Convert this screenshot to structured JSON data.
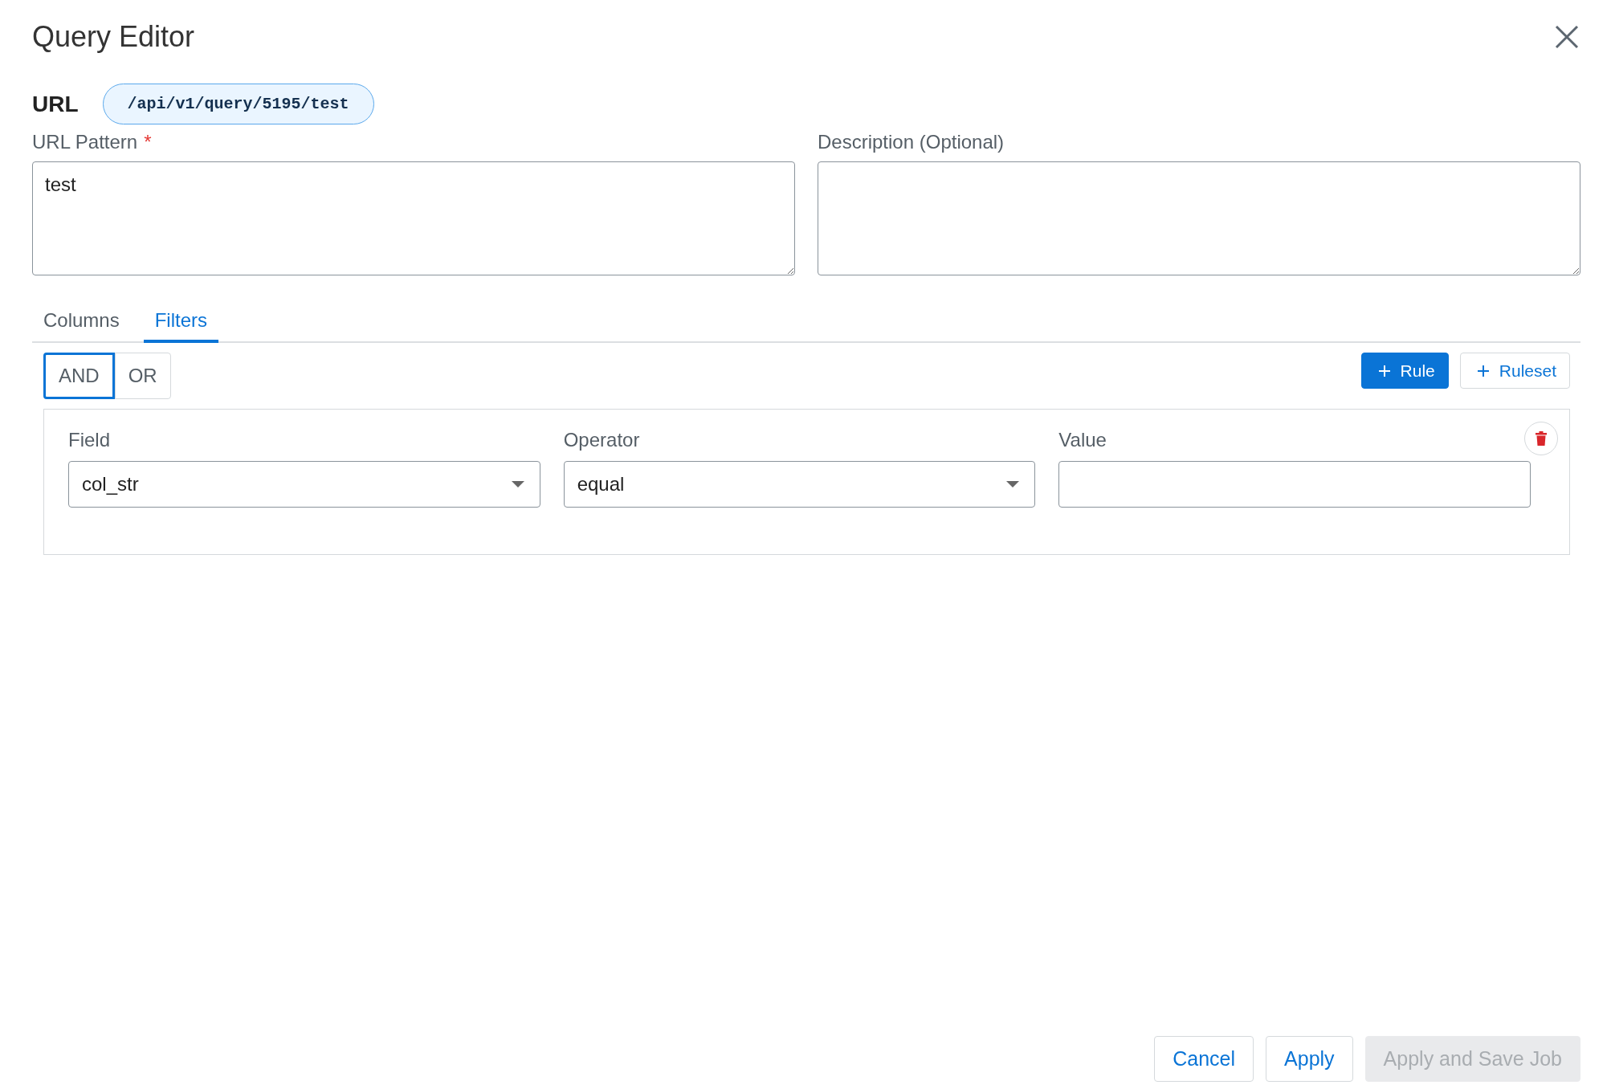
{
  "dialog": {
    "title": "Query Editor"
  },
  "url": {
    "label": "URL",
    "path": "/api/v1/query/5195/test"
  },
  "fields": [
    {
      "label": "URL Pattern",
      "required_mark": "*",
      "value": "test"
    },
    {
      "label": "Description (Optional)"
    }
  ],
  "tabs": [
    {
      "label": "Columns",
      "selected": false
    },
    {
      "label": "Filters",
      "selected": true
    }
  ],
  "conjunctions": [
    {
      "label": "AND",
      "selected": true
    },
    {
      "label": "OR",
      "selected": false
    }
  ],
  "add_buttons": [
    {
      "label": "Rule",
      "kind": "primary"
    },
    {
      "label": "Ruleset",
      "kind": "outline"
    }
  ],
  "rule": {
    "inputs": [
      {
        "label": "Field",
        "kind": "select",
        "value": "col_str"
      },
      {
        "label": "Operator",
        "kind": "select",
        "value": "equal"
      },
      {
        "label": "Value",
        "kind": "text"
      }
    ]
  },
  "footer_buttons": [
    {
      "label": "Cancel",
      "disabled": false
    },
    {
      "label": "Apply",
      "disabled": false
    },
    {
      "label": "Apply and Save Job",
      "disabled": true
    }
  ]
}
